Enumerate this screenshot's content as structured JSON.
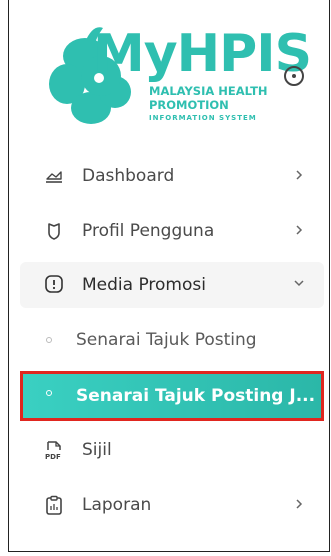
{
  "logo": {
    "title": "MyHPIS",
    "line1": "MALAYSIA HEALTH",
    "line2": "PROMOTION",
    "line3": "INFORMATION SYSTEM",
    "color": "#2fbfb0"
  },
  "collapse_icon": "circle-dot-icon",
  "menu": {
    "dashboard": {
      "label": "Dashboard",
      "icon": "chart-area-icon"
    },
    "profil": {
      "label": "Profil Pengguna",
      "icon": "shield-icon"
    },
    "media": {
      "label": "Media Promosi",
      "icon": "alert-circle-icon"
    },
    "sub1": {
      "label": "Senarai Tajuk Posting"
    },
    "sub2": {
      "label": "Senarai Tajuk Posting J..."
    },
    "sijil": {
      "label": "Sijil",
      "icon": "pdf-file-icon"
    },
    "laporan": {
      "label": "Laporan",
      "icon": "clipboard-icon"
    }
  },
  "colors": {
    "accent": "#2fbfb0",
    "highlight_border": "#e0261f"
  }
}
